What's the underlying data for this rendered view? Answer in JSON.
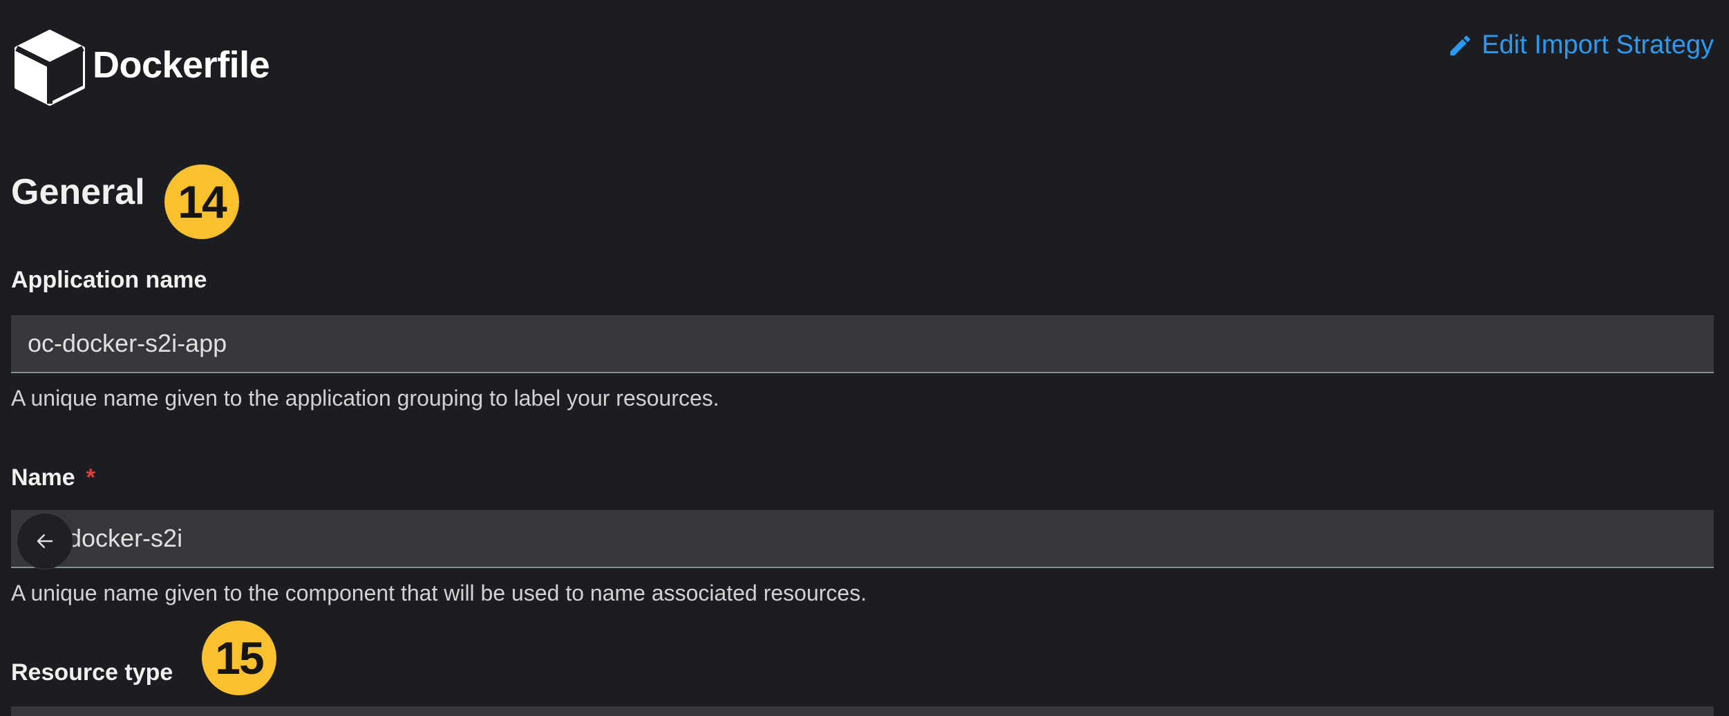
{
  "header": {
    "title": "Dockerfile",
    "logo_icon": "cube-icon",
    "edit_link": "Edit Import Strategy",
    "edit_icon": "pencil-icon"
  },
  "section": {
    "title": "General"
  },
  "badges": {
    "step_14": "14",
    "step_15": "15"
  },
  "fields": {
    "application_name": {
      "label": "Application name",
      "value": "oc-docker-s2i-app",
      "help": "A unique name given to the application grouping to label your resources."
    },
    "name": {
      "label": "Name",
      "required_marker": "*",
      "value": "docker-s2i",
      "help": "A unique name given to the component that will be used to name associated resources."
    },
    "resource_type": {
      "label": "Resource type"
    }
  },
  "colors": {
    "background": "#1b1d21",
    "link": "#2b9af3",
    "badge": "#f8c12d",
    "required": "#e0413a",
    "input_bg": "#36373b"
  }
}
